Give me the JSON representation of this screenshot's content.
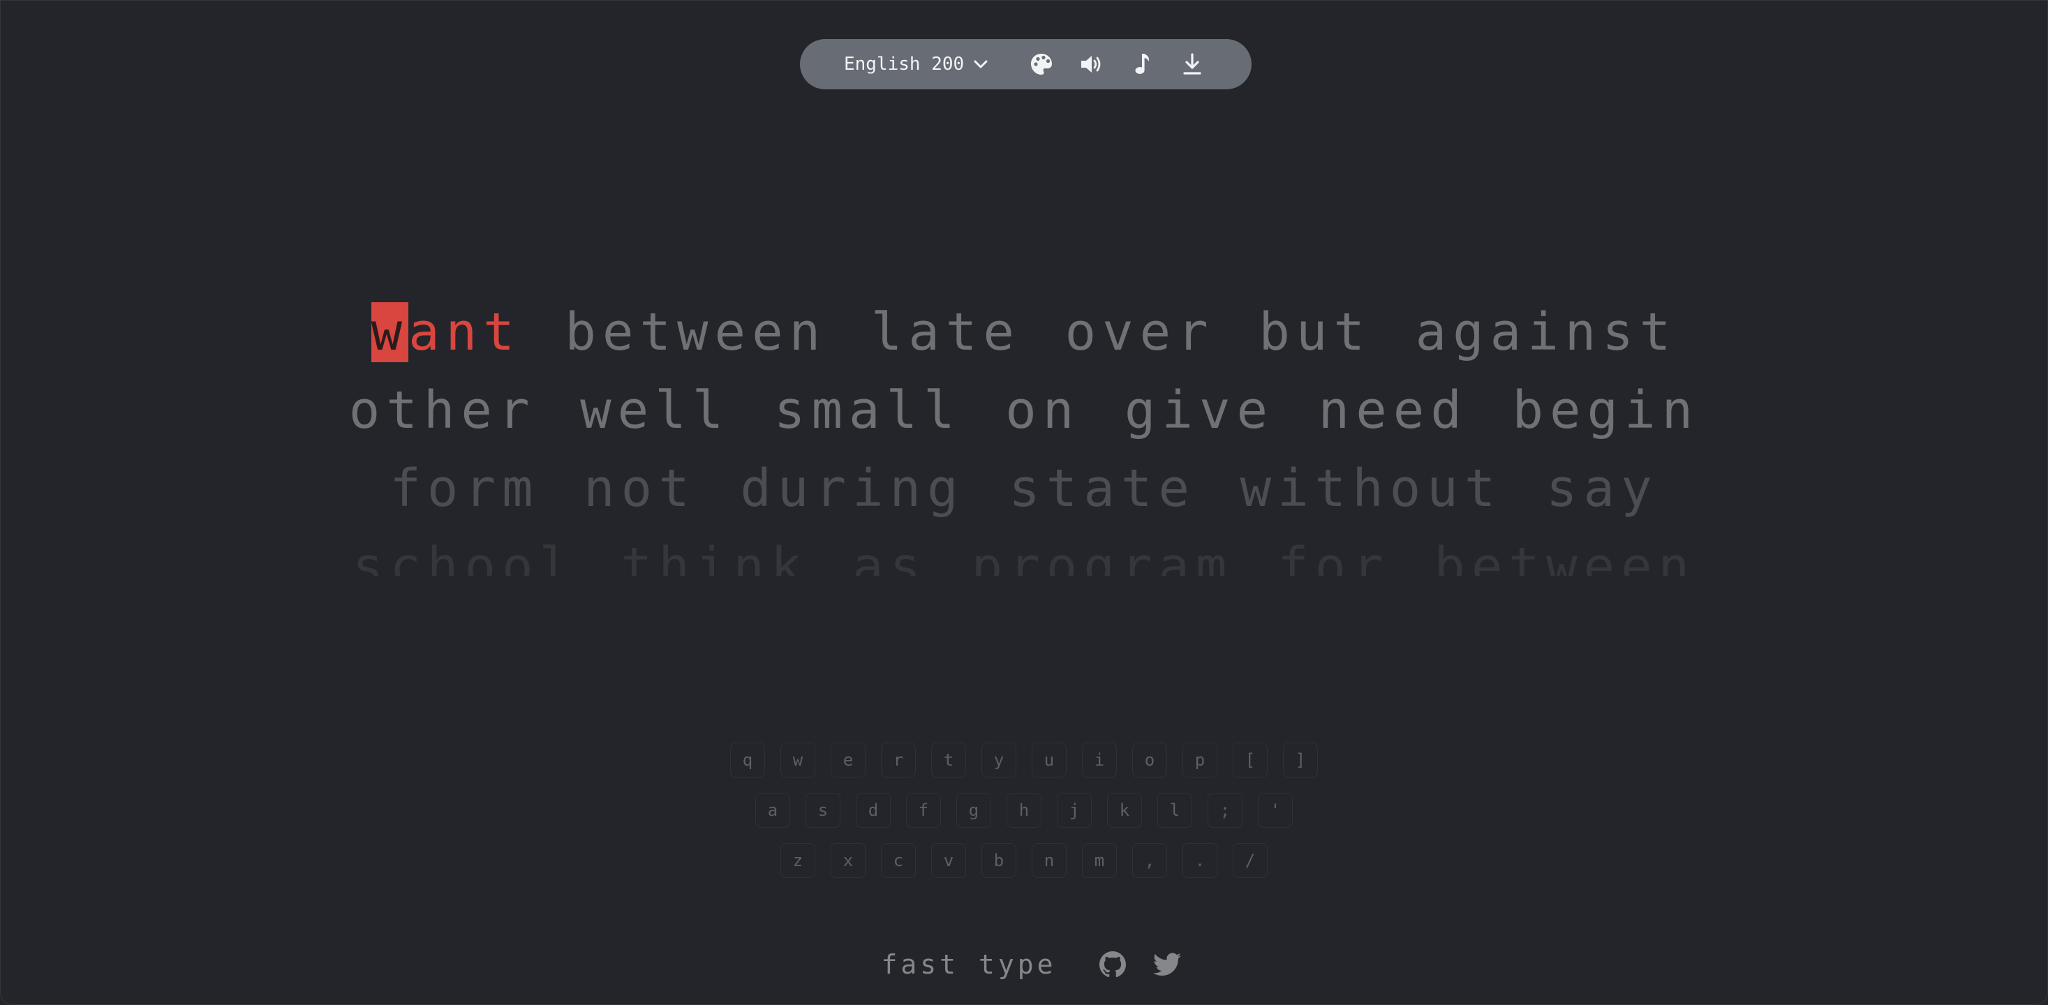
{
  "toolbar": {
    "language_label": "English 200",
    "icons": [
      "palette-icon",
      "volume-icon",
      "music-note-icon",
      "download-icon"
    ]
  },
  "typing": {
    "current_word": {
      "cursor_letter": "w",
      "typed_rest": "ant"
    },
    "line1_rest": [
      "between",
      "late",
      "over",
      "but",
      "against"
    ],
    "line2": [
      "other",
      "well",
      "small",
      "on",
      "give",
      "need",
      "begin"
    ],
    "line3": [
      "form",
      "not",
      "during",
      "state",
      "without",
      "say"
    ],
    "line4": [
      "school",
      "think",
      "as",
      "program",
      "for",
      "between"
    ]
  },
  "keyboard": {
    "row1": [
      "q",
      "w",
      "e",
      "r",
      "t",
      "y",
      "u",
      "i",
      "o",
      "p",
      "[",
      "]"
    ],
    "row2": [
      "a",
      "s",
      "d",
      "f",
      "g",
      "h",
      "j",
      "k",
      "l",
      ";",
      "'"
    ],
    "row3": [
      "z",
      "x",
      "c",
      "v",
      "b",
      "n",
      "m",
      ",",
      ".",
      "/"
    ]
  },
  "footer": {
    "brand": "fast type",
    "links": [
      "github-icon",
      "twitter-icon"
    ]
  },
  "colors": {
    "background": "#23252a",
    "toolbar": "#686d75",
    "error": "#d9463f",
    "text_upcoming": "#6f7175"
  }
}
